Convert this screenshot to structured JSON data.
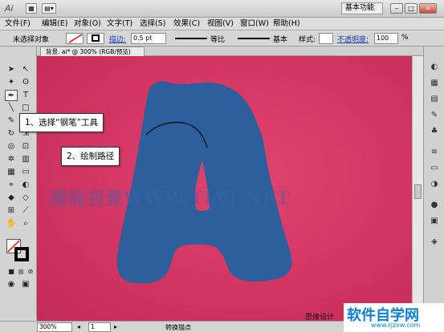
{
  "app": {
    "logo": "Ai"
  },
  "workspace": {
    "label": "基本功能"
  },
  "window_buttons": {
    "minimize": "–",
    "restore": "□",
    "close": "✕"
  },
  "menu": [
    {
      "label": "文件(F)"
    },
    {
      "label": "编辑(E)"
    },
    {
      "label": "对象(O)"
    },
    {
      "label": "文字(T)"
    },
    {
      "label": "选择(S)"
    },
    {
      "label": "效果(C)"
    },
    {
      "label": "视图(V)"
    },
    {
      "label": "窗口(W)"
    },
    {
      "label": "帮助(H)"
    }
  ],
  "control": {
    "selection_label": "未选择对象",
    "stroke_label": "描边:",
    "stroke_value": "0.5 pt",
    "stroke_profile": "等比",
    "brush_label": "基本",
    "style_label": "样式:",
    "opacity_label": "不透明度:",
    "opacity_value": "100",
    "opacity_unit": "%"
  },
  "document": {
    "tab_title": "背景. ai* @ 300% (RGB/预览)"
  },
  "callouts": {
    "step1": "1、选择“钢笔”工具",
    "step2": "2、绘制路径"
  },
  "watermark": {
    "text": "騰龍視覺WWW.TLVI.NET",
    "bottom": "思缘设计"
  },
  "site_logo": {
    "big": "软件自学网",
    "small": "www.rjzxw.com"
  },
  "status": {
    "zoom": "300%",
    "page": "1",
    "tool_info": "转换锚点"
  },
  "colors": {
    "canvas": "#d33562",
    "letter_fill": "#2e5f9a"
  }
}
